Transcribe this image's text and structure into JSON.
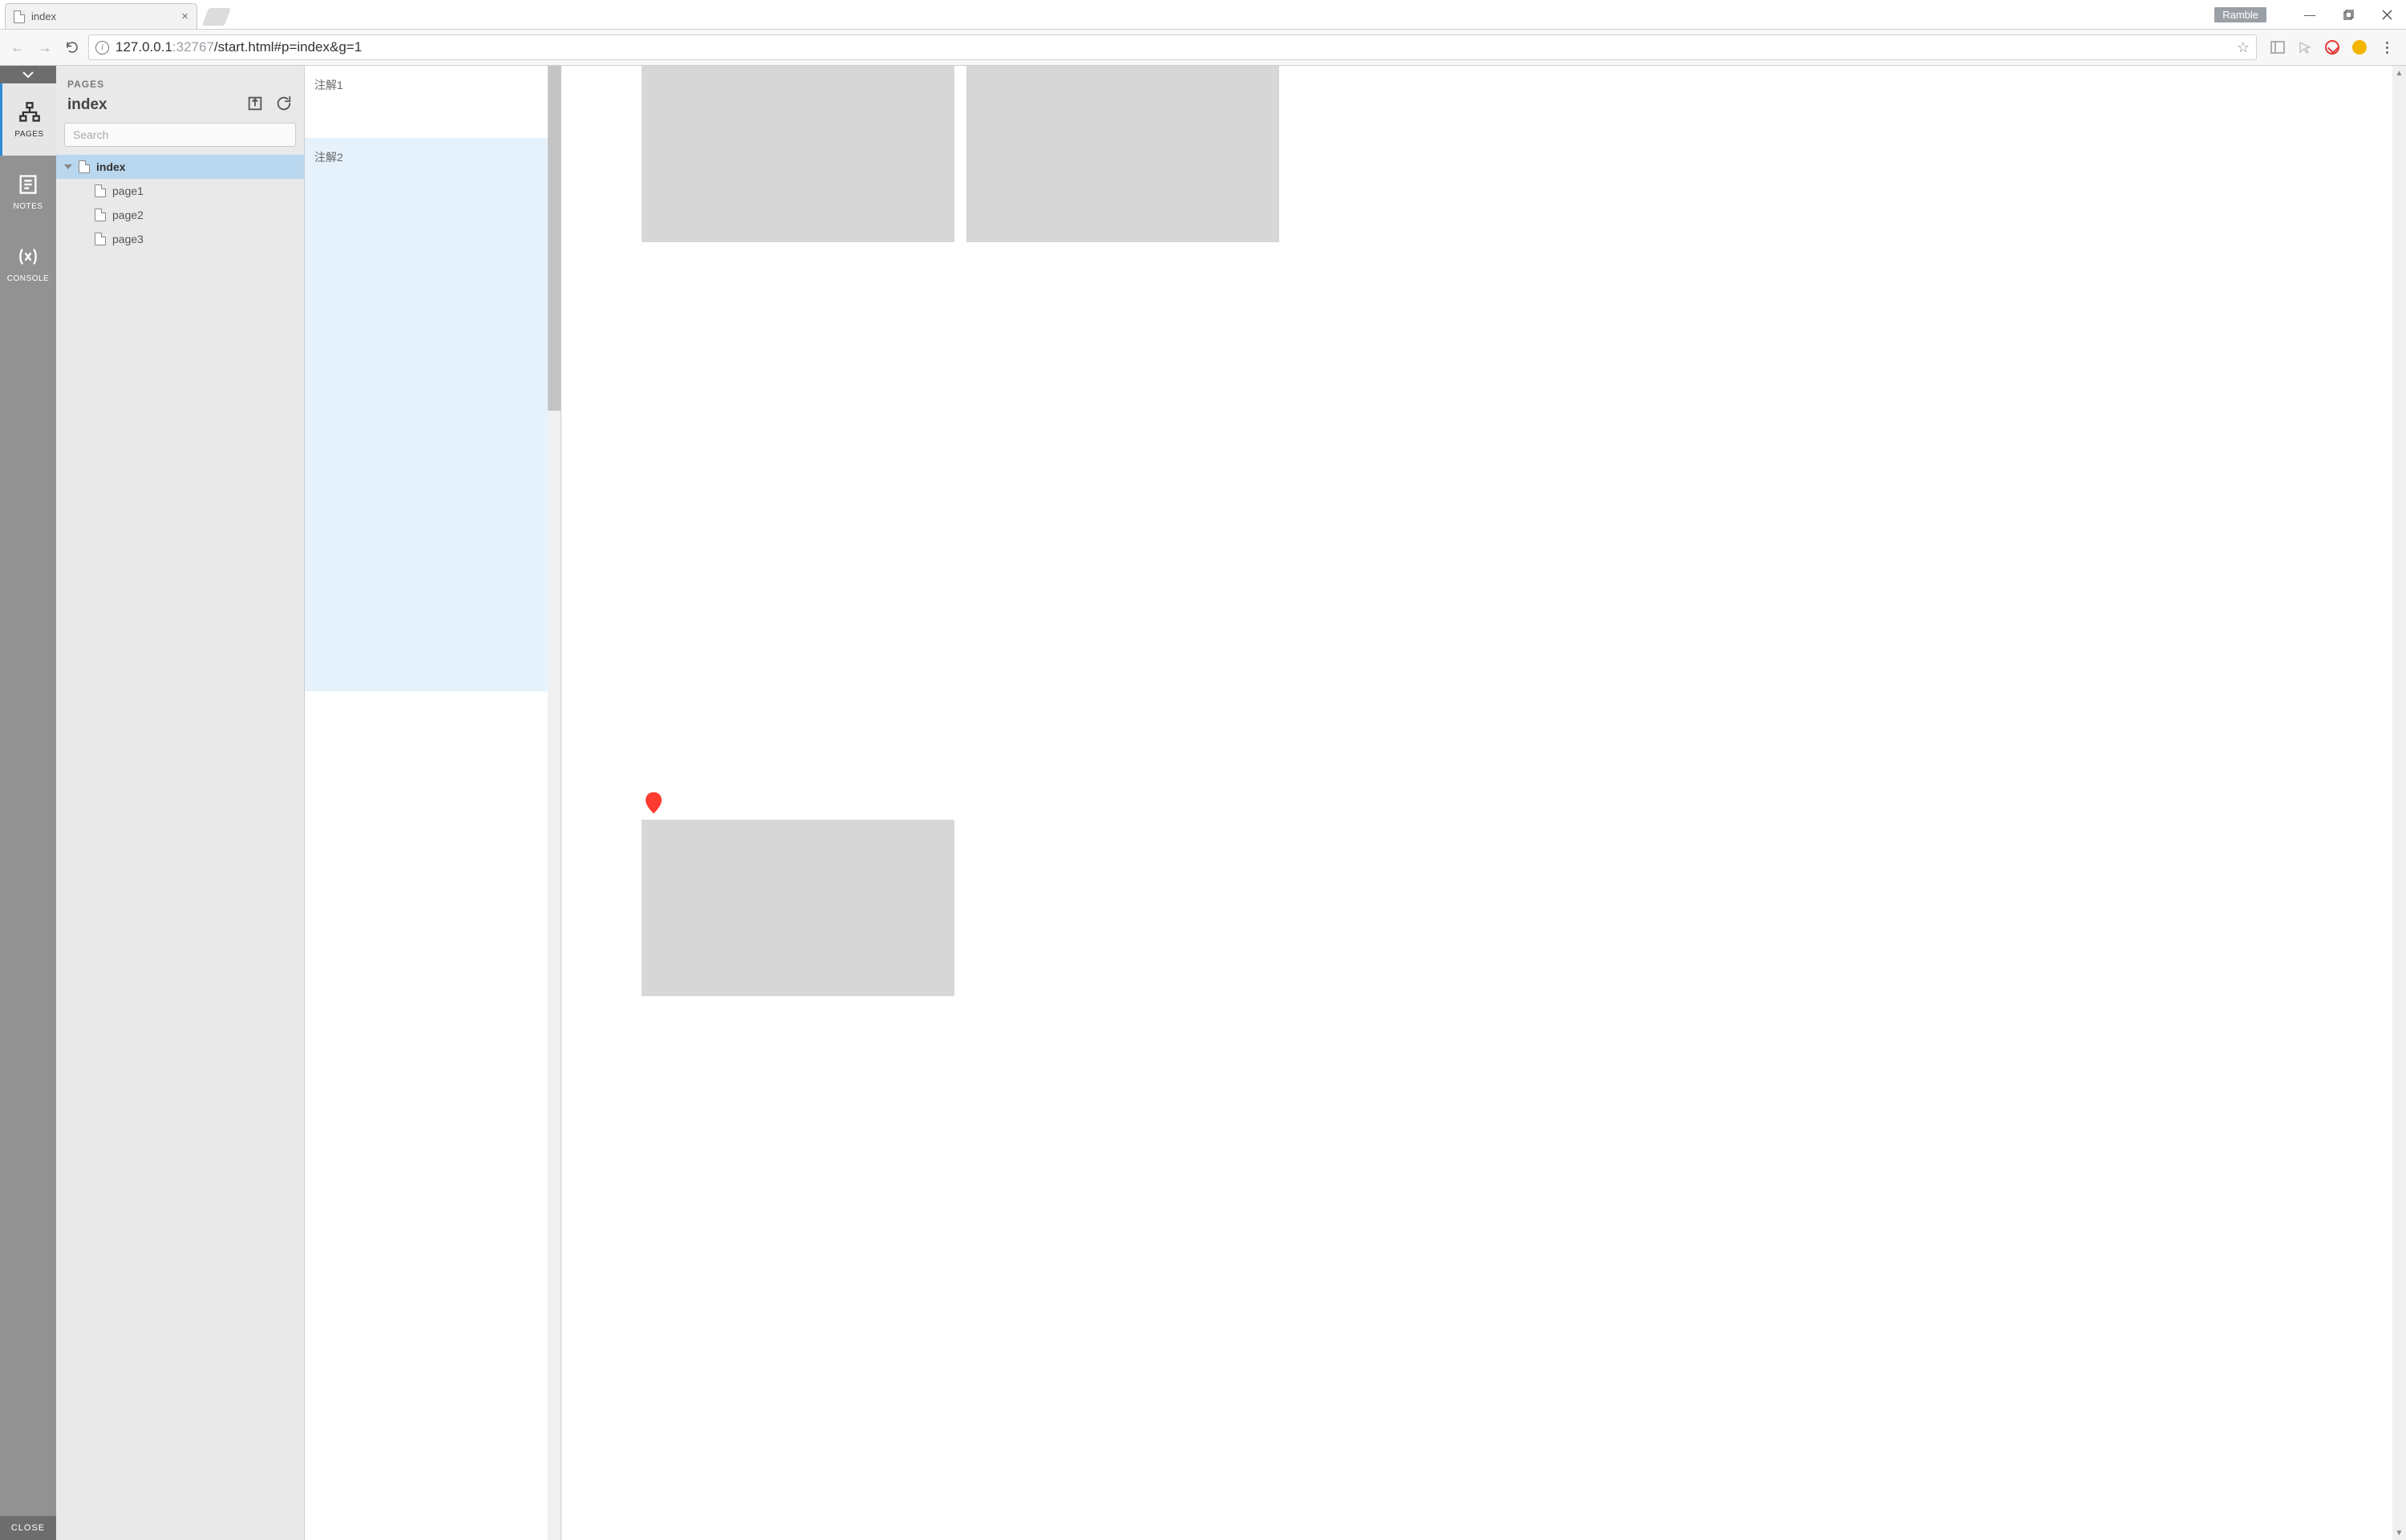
{
  "browser": {
    "tab_title": "index",
    "badge": "Ramble",
    "url_host": "127.0.0.1",
    "url_port": ":32767",
    "url_path": "/start.html#p=index&g=1"
  },
  "rail": {
    "pages": "PAGES",
    "notes": "NOTES",
    "console": "CONSOLE",
    "close": "CLOSE"
  },
  "pages_panel": {
    "label": "PAGES",
    "title": "index",
    "search_placeholder": "Search",
    "tree": {
      "root": "index",
      "children": [
        "page1",
        "page2",
        "page3"
      ]
    }
  },
  "notes_panel": {
    "items": [
      "注解1",
      "注解2"
    ]
  }
}
